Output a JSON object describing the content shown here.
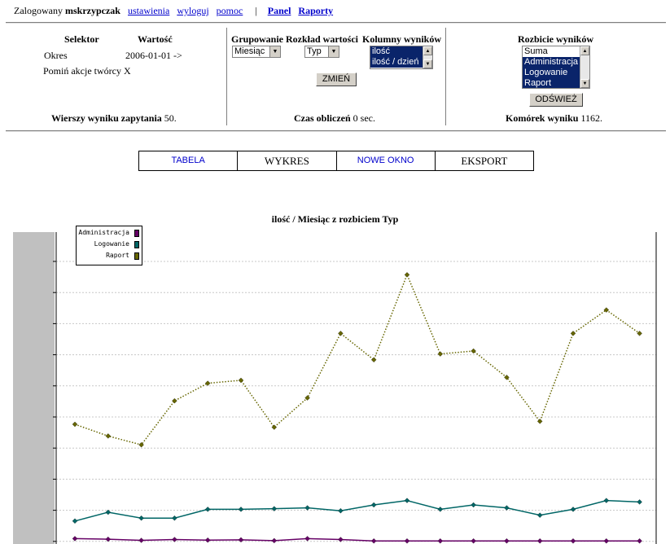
{
  "topbar": {
    "logged_prefix": "Zalogowany",
    "username": "mskrzypczak",
    "links": [
      "ustawienia",
      "wyloguj",
      "pomoc"
    ],
    "separator": "|",
    "nav_links": [
      "Panel",
      "Raporty"
    ]
  },
  "selector": {
    "col_selector": "Selektor",
    "col_value": "Wartość",
    "rows": [
      {
        "label": "Okres",
        "value": "2006-01-01 ->"
      },
      {
        "label": "Pomiń akcje twórcy X",
        "value": ""
      }
    ],
    "rows_label": "Wierszy wyniku zapytania",
    "rows_value": "50."
  },
  "grouping": {
    "label_group": "Grupowanie",
    "label_distribution": "Rozkład wartości",
    "label_columns": "Kolumny wyników",
    "group_value": "Miesiąc",
    "distribution_value": "Typ",
    "columns_options": [
      "ilość",
      "ilość / dzień"
    ],
    "change_button": "ZMIEŃ",
    "time_label": "Czas obliczeń",
    "time_value": "0 sec."
  },
  "breakdown": {
    "label": "Rozbicie wyników",
    "options": [
      "Suma",
      "Administracja",
      "Logowanie",
      "Raport"
    ],
    "selected": [
      "Administracja",
      "Logowanie",
      "Raport"
    ],
    "refresh_button": "ODŚWIEŻ",
    "cells_label": "Komórek wyniku",
    "cells_value": "1162."
  },
  "tabs": [
    {
      "label": "TABELA",
      "style": "link"
    },
    {
      "label": "WYKRES",
      "style": "plain"
    },
    {
      "label": "NOWE OKNO",
      "style": "link"
    },
    {
      "label": "EKSPORT",
      "style": "plain"
    }
  ],
  "chart_data": {
    "type": "line",
    "title": "ilość / Miesiąc z rozbiciem Typ",
    "xlabel": "",
    "ylabel": "",
    "ylim": [
      0,
      100
    ],
    "grid": true,
    "legend_placement": "top-left",
    "series": [
      {
        "name": "Administracja",
        "color": "#660066",
        "style": "solid",
        "values": [
          1,
          0.8,
          0.4,
          0.7,
          0.5,
          0.6,
          0.3,
          1.0,
          0.7,
          0.2,
          0.2,
          0.2,
          0.2,
          0.2,
          0.2,
          0.2,
          0.2,
          0.2
        ]
      },
      {
        "name": "Logowanie",
        "color": "#006666",
        "style": "solid",
        "values": [
          7,
          10,
          8,
          8,
          11,
          11,
          11.2,
          11.5,
          10.5,
          12.5,
          14,
          11,
          12.5,
          11.5,
          9,
          11,
          14,
          13.5
        ]
      },
      {
        "name": "Raport",
        "color": "#666600",
        "style": "dotted",
        "values": [
          40,
          36,
          33,
          48,
          54,
          55,
          39,
          49,
          71,
          62,
          91,
          64,
          65,
          56,
          41,
          71,
          79,
          71
        ]
      }
    ]
  }
}
